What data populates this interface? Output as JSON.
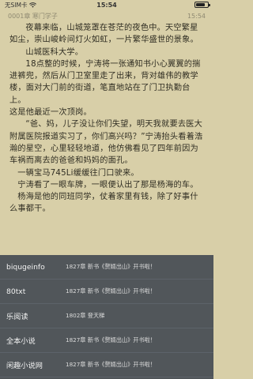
{
  "status_bar": {
    "carrier": "无SIM卡",
    "wifi_icon": "wifi-icon",
    "time": "15:54",
    "battery_level": 0.8
  },
  "chapter_bar": {
    "title": "0001章 寒门学子",
    "time": "15:54"
  },
  "content": {
    "paragraphs": [
      "夜幕来临，山城笼罩在苍茫的夜色中。天空繁星如尘，崇山峻岭间灯火如虹，一片繁华盛世的景象。",
      "山城医科大学。",
      "18点整的时候，宁涛将一张通知书小心翼翼的揣进裤兜，然后从门卫室里走了出来，背对雄伟的教学楼，面对大门前的街道，笔直地站在了门卫执勤台上。",
      "这是他最近一次顶岗。",
      "“爸、妈，儿子没让你们失望，明天我就要去医大附属医院报道实习了，你们高兴吗？”宁涛抬头看着浩瀚的星空，心里轻轻地道，他仿佛看见了四年前因为车祸而离去的爸爸和妈妈的面孔。",
      "一辆宝马745Li缓缓往门口驶来。",
      "宁涛看了一眼车牌，一眼便认出了那是杨海的车。",
      "杨海是他的同班同学，仗着家里有钱，除了好事什么事都干。"
    ]
  },
  "sources": [
    {
      "name": "biqugeinfo",
      "latest": "1827章 新书《赘婿出山》开书啦！"
    },
    {
      "name": "80txt",
      "latest": "1827章 新书《赘婿出山》开书啦！"
    },
    {
      "name": "乐阅读",
      "latest": "1802章 登天梯"
    },
    {
      "name": "全本小说",
      "latest": "1827章 新书《赘婿出山》开书啦！"
    },
    {
      "name": "闲趣小说网",
      "latest": "1827章 新书《赘婿出山》开书啦！"
    }
  ]
}
